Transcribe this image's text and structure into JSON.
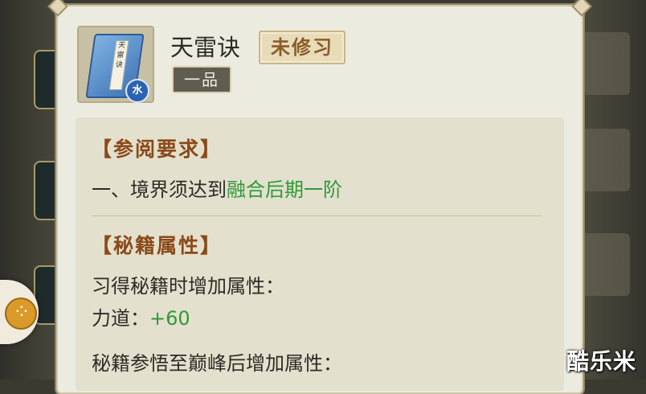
{
  "item": {
    "name": "天雷诀",
    "status_tag": "未修习",
    "grade_tag": "一品",
    "element_badge": "水",
    "icon": "book-icon",
    "book_strip_text": [
      "天",
      "雷",
      "诀"
    ]
  },
  "requirements": {
    "title": "【参阅要求】",
    "line_prefix": "一、境界须达到",
    "line_highlight": "融合后期一阶"
  },
  "attributes": {
    "title": "【秘籍属性】",
    "learn_text": "习得秘籍时增加属性：",
    "stat_label": "力道：",
    "stat_value": "+60",
    "peak_text": "秘籍参悟至巅峰后增加属性："
  },
  "watermark": "酷乐米",
  "colors": {
    "highlight_green": "#2f9a3a",
    "section_brown": "#8a4a19",
    "element_blue": "#2c63b0"
  }
}
